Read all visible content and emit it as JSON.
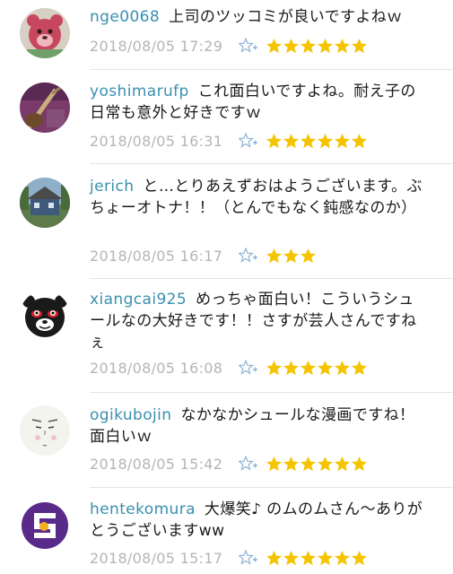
{
  "comments": [
    {
      "user": "nge0068",
      "text": "上司のツッコミが良いですよねｗ",
      "date": "2018/08/05 17:29",
      "stars": 6,
      "avatar": "red-bear-avatar"
    },
    {
      "user": "yoshimarufp",
      "text": "これ面白いですよね。耐え子の日常も意外と好きですｗ",
      "date": "2018/08/05 16:31",
      "stars": 6,
      "avatar": "guitar-avatar"
    },
    {
      "user": "jerich",
      "text": "と…とりあえずおはようございます。ぶちょーオトナ！！（とんでもなく鈍感なのか）",
      "date": "2018/08/05 16:17",
      "stars": 3,
      "avatar": "house-avatar"
    },
    {
      "user": "xiangcai925",
      "text": "めっちゃ面白い！こういうシュールなの大好きです！！さすが芸人さんですねぇ",
      "date": "2018/08/05 16:08",
      "stars": 6,
      "avatar": "black-bear-avatar"
    },
    {
      "user": "ogikubojin",
      "text": "なかなかシュールな漫画ですね！面白いｗ",
      "date": "2018/08/05 15:42",
      "stars": 6,
      "avatar": "face-sketch-avatar"
    },
    {
      "user": "hentekomura",
      "text": "大爆笑♪ のムのムさん〜ありがとうございますww",
      "date": "2018/08/05 15:17",
      "stars": 6,
      "avatar": "purple-logo-avatar"
    }
  ],
  "colors": {
    "username": "#3a8fb0",
    "date": "#b5b5b5",
    "star": "#f5c400",
    "add_star": "#8fb4d6"
  }
}
